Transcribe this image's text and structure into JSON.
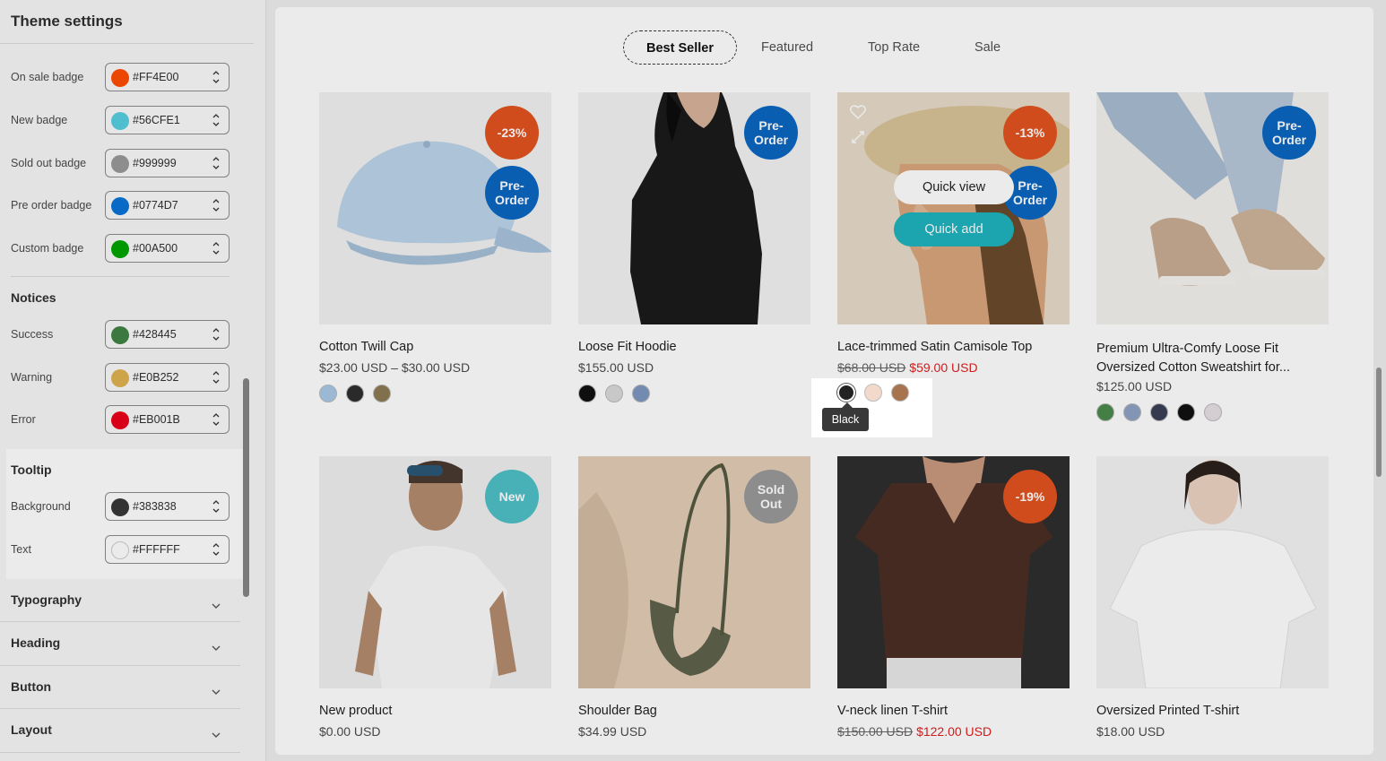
{
  "sidebar": {
    "title": "Theme settings",
    "badges": [
      {
        "label": "On sale badge",
        "hex": "#FF4E00",
        "color": "#FF4E00"
      },
      {
        "label": "New badge",
        "hex": "#56CFE1",
        "color": "#56CFE1"
      },
      {
        "label": "Sold out badge",
        "hex": "#999999",
        "color": "#999999"
      },
      {
        "label": "Pre order badge",
        "hex": "#0774D7",
        "color": "#0774D7"
      },
      {
        "label": "Custom badge",
        "hex": "#00A500",
        "color": "#00A500"
      }
    ],
    "notices_title": "Notices",
    "notices": [
      {
        "label": "Success",
        "hex": "#428445",
        "color": "#428445"
      },
      {
        "label": "Warning",
        "hex": "#E0B252",
        "color": "#E0B252"
      },
      {
        "label": "Error",
        "hex": "#EB001B",
        "color": "#EB001B"
      }
    ],
    "tooltip_title": "Tooltip",
    "tooltip": [
      {
        "label": "Background",
        "hex": "#383838",
        "color": "#383838"
      },
      {
        "label": "Text",
        "hex": "#FFFFFF",
        "color": "#FFFFFF"
      }
    ],
    "collapsibles": [
      "Typography",
      "Heading",
      "Button",
      "Layout"
    ]
  },
  "preview": {
    "tabs": [
      "Best Seller",
      "Featured",
      "Top Rate",
      "Sale"
    ],
    "active_tab": "Best Seller",
    "products": [
      {
        "name": "Cotton Twill Cap",
        "price": "$23.00 USD – $30.00 USD",
        "badges": [
          {
            "text": "-23%",
            "color": "#E2531F"
          },
          {
            "text": "Pre-\nOrder",
            "color": "#0B66C2"
          }
        ]
      },
      {
        "name": "Loose Fit Hoodie",
        "price": "$155.00 USD",
        "badges": [
          {
            "text": "Pre-\nOrder",
            "color": "#0B66C2"
          }
        ]
      },
      {
        "name": "Lace-trimmed Satin Camisole Top",
        "old_price": "$68.00 USD",
        "new_price": "$59.00 USD",
        "badges": [
          {
            "text": "-13%",
            "color": "#E2531F"
          },
          {
            "text": "Pre-\nOrder",
            "color": "#0B66C2"
          }
        ],
        "quick_view": "Quick view",
        "quick_add": "Quick add"
      },
      {
        "name": "Premium Ultra-Comfy Loose Fit Oversized Cotton Sweatshirt for...",
        "price": "$125.00 USD",
        "badges": [
          {
            "text": "Pre-\nOrder",
            "color": "#0B66C2"
          }
        ]
      },
      {
        "name": "New product",
        "price": "$0.00 USD",
        "badges": [
          {
            "text": "New",
            "color": "#4FBFC7"
          }
        ]
      },
      {
        "name": "Shoulder Bag",
        "price": "$34.99 USD",
        "badges": [
          {
            "text": "Sold\nOut",
            "color": "#9A9A9A"
          }
        ]
      },
      {
        "name": "V-neck linen T-shirt",
        "old_price": "$150.00 USD",
        "new_price": "$122.00 USD",
        "badges": [
          {
            "text": "-19%",
            "color": "#E2531F"
          }
        ]
      },
      {
        "name": "Oversized Printed T-shirt",
        "price": "$18.00 USD",
        "badges": []
      }
    ],
    "tooltip_text": "Black"
  }
}
